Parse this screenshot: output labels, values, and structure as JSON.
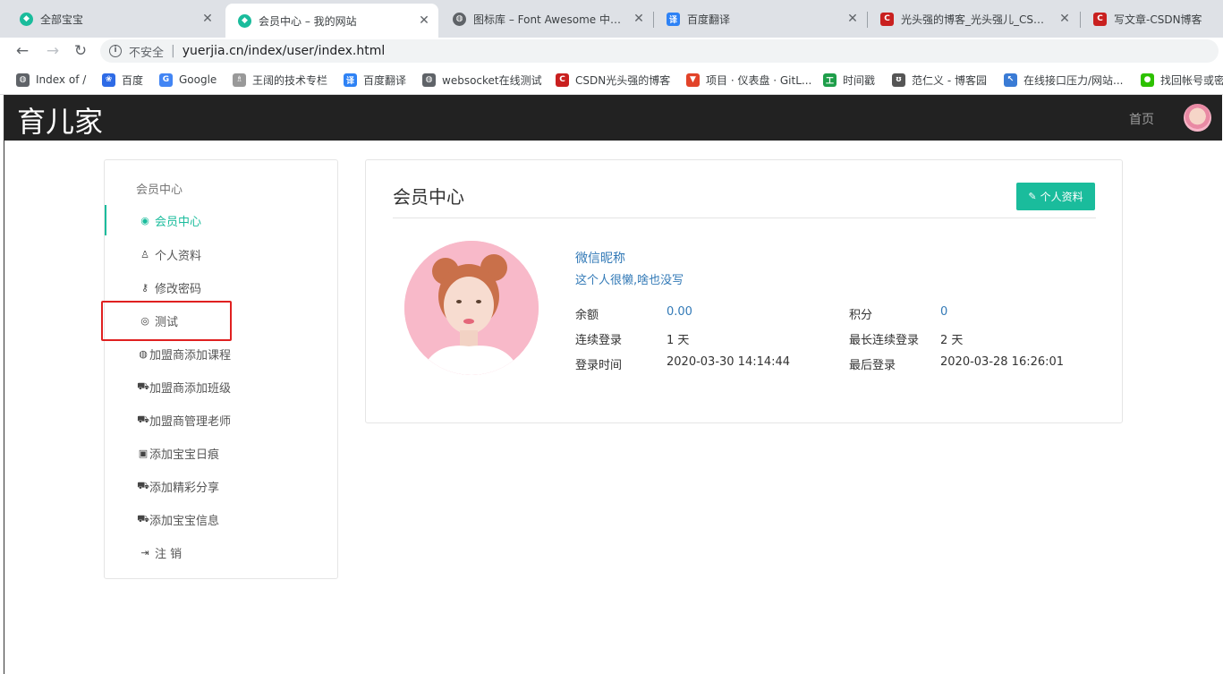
{
  "browser": {
    "tabs": [
      {
        "title": "全部宝宝",
        "color": "#1abc9c",
        "glyph": "◆"
      },
      {
        "title": "会员中心 – 我的网站",
        "color": "#1abc9c",
        "glyph": "◆"
      },
      {
        "title": "图标库 – Font Awesome 中文网",
        "color": "#5f6368",
        "glyph": "◍"
      },
      {
        "title": "百度翻译",
        "color": "#2e82f5",
        "glyph": "译"
      },
      {
        "title": "光头强的博客_光头强儿_CSDN博客",
        "color": "#c9201f",
        "glyph": "C"
      },
      {
        "title": "写文章-CSDN博客",
        "color": "#c9201f",
        "glyph": "C"
      }
    ],
    "address": {
      "security_label": "不安全",
      "url": "yuerjia.cn/index/user/index.html"
    },
    "bookmarks": [
      {
        "label": "Index of /",
        "color": "#5f6368",
        "glyph": "◍"
      },
      {
        "label": "百度",
        "color": "#2e6be6",
        "glyph": "❀"
      },
      {
        "label": "Google",
        "color": "#4285f4",
        "glyph": "G"
      },
      {
        "label": "王阔的技术专栏",
        "color": "#999999",
        "glyph": "♗"
      },
      {
        "label": "百度翻译",
        "color": "#2e82f5",
        "glyph": "译"
      },
      {
        "label": "websocket在线测试",
        "color": "#5f6368",
        "glyph": "◍"
      },
      {
        "label": "CSDN光头强的博客",
        "color": "#c9201f",
        "glyph": "C"
      },
      {
        "label": "项目 · 仪表盘 · GitL...",
        "color": "#e24329",
        "glyph": "▼"
      },
      {
        "label": "时间戳",
        "color": "#1e9e4a",
        "glyph": "工"
      },
      {
        "label": "范仁义 - 博客园",
        "color": "#555555",
        "glyph": "ʊ"
      },
      {
        "label": "在线接口压力/网站...",
        "color": "#3a7bd5",
        "glyph": "↖"
      },
      {
        "label": "找回帐号或密",
        "color": "#2dc100",
        "glyph": "●"
      }
    ]
  },
  "site": {
    "brand": "育儿家",
    "nav_home": "首页"
  },
  "sidebar": {
    "title": "会员中心",
    "items": [
      {
        "label": "会员中心",
        "icon": "user-circle-icon",
        "glyph": "◉"
      },
      {
        "label": "个人资料",
        "icon": "user-icon",
        "glyph": "♙"
      },
      {
        "label": "修改密码",
        "icon": "key-icon",
        "glyph": "⚷"
      },
      {
        "label": "测试",
        "icon": "compass-icon",
        "glyph": "◎"
      },
      {
        "label": "加盟商添加课程",
        "icon": "life-ring-icon",
        "glyph": "◍"
      },
      {
        "label": "加盟商添加班级",
        "icon": "car-icon",
        "glyph": "⛟"
      },
      {
        "label": "加盟商管理老师",
        "icon": "car-icon",
        "glyph": "⛟"
      },
      {
        "label": "添加宝宝日痕",
        "icon": "train-icon",
        "glyph": "▣"
      },
      {
        "label": "添加精彩分享",
        "icon": "car-icon",
        "glyph": "⛟"
      },
      {
        "label": "添加宝宝信息",
        "icon": "car-icon",
        "glyph": "⛟"
      },
      {
        "label": "注 销",
        "icon": "sign-out-icon",
        "glyph": "⇥"
      }
    ]
  },
  "main": {
    "title": "会员中心",
    "profile_button": "个人资料",
    "nickname": "微信昵称",
    "motto": "这个人很懒,啥也没写",
    "stats": [
      {
        "label": "余额",
        "value": "0.00",
        "link": true
      },
      {
        "label": "积分",
        "value": "0",
        "link": true
      },
      {
        "label": "连续登录",
        "value": "1 天",
        "link": false
      },
      {
        "label": "最长连续登录",
        "value": "2 天",
        "link": false
      },
      {
        "label": "登录时间",
        "value": "2020-03-30 14:14:44",
        "link": false
      },
      {
        "label": "最后登录",
        "value": "2020-03-28 16:26:01",
        "link": false
      }
    ]
  },
  "colors": {
    "accent": "#1abc9c",
    "link": "#337ab7",
    "navbar": "#222222",
    "highlight": "#e02020"
  }
}
